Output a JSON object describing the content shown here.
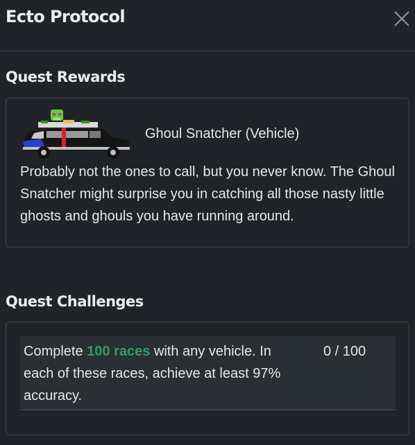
{
  "dialog": {
    "title": "Ecto Protocol"
  },
  "rewards": {
    "heading": "Quest Rewards",
    "item": {
      "name": "Ghoul Snatcher (Vehicle)",
      "description": "Probably not the ones to call, but you never know. The Ghoul Snatcher might surprise you in catching all those nasty little ghosts and ghouls you have running around.",
      "icon": "hearse-vehicle-image"
    }
  },
  "challenges": {
    "heading": "Quest Challenges",
    "items": [
      {
        "text_before": "Complete ",
        "highlight": "100 races",
        "text_after": " with any vehicle. In each of these races, achieve at least 97% accuracy.",
        "progress_text": "0 / 100",
        "progress_current": 0,
        "progress_target": 100
      }
    ]
  },
  "colors": {
    "background": "#202428",
    "highlight": "#2f9e61",
    "border": "#3f444a"
  }
}
